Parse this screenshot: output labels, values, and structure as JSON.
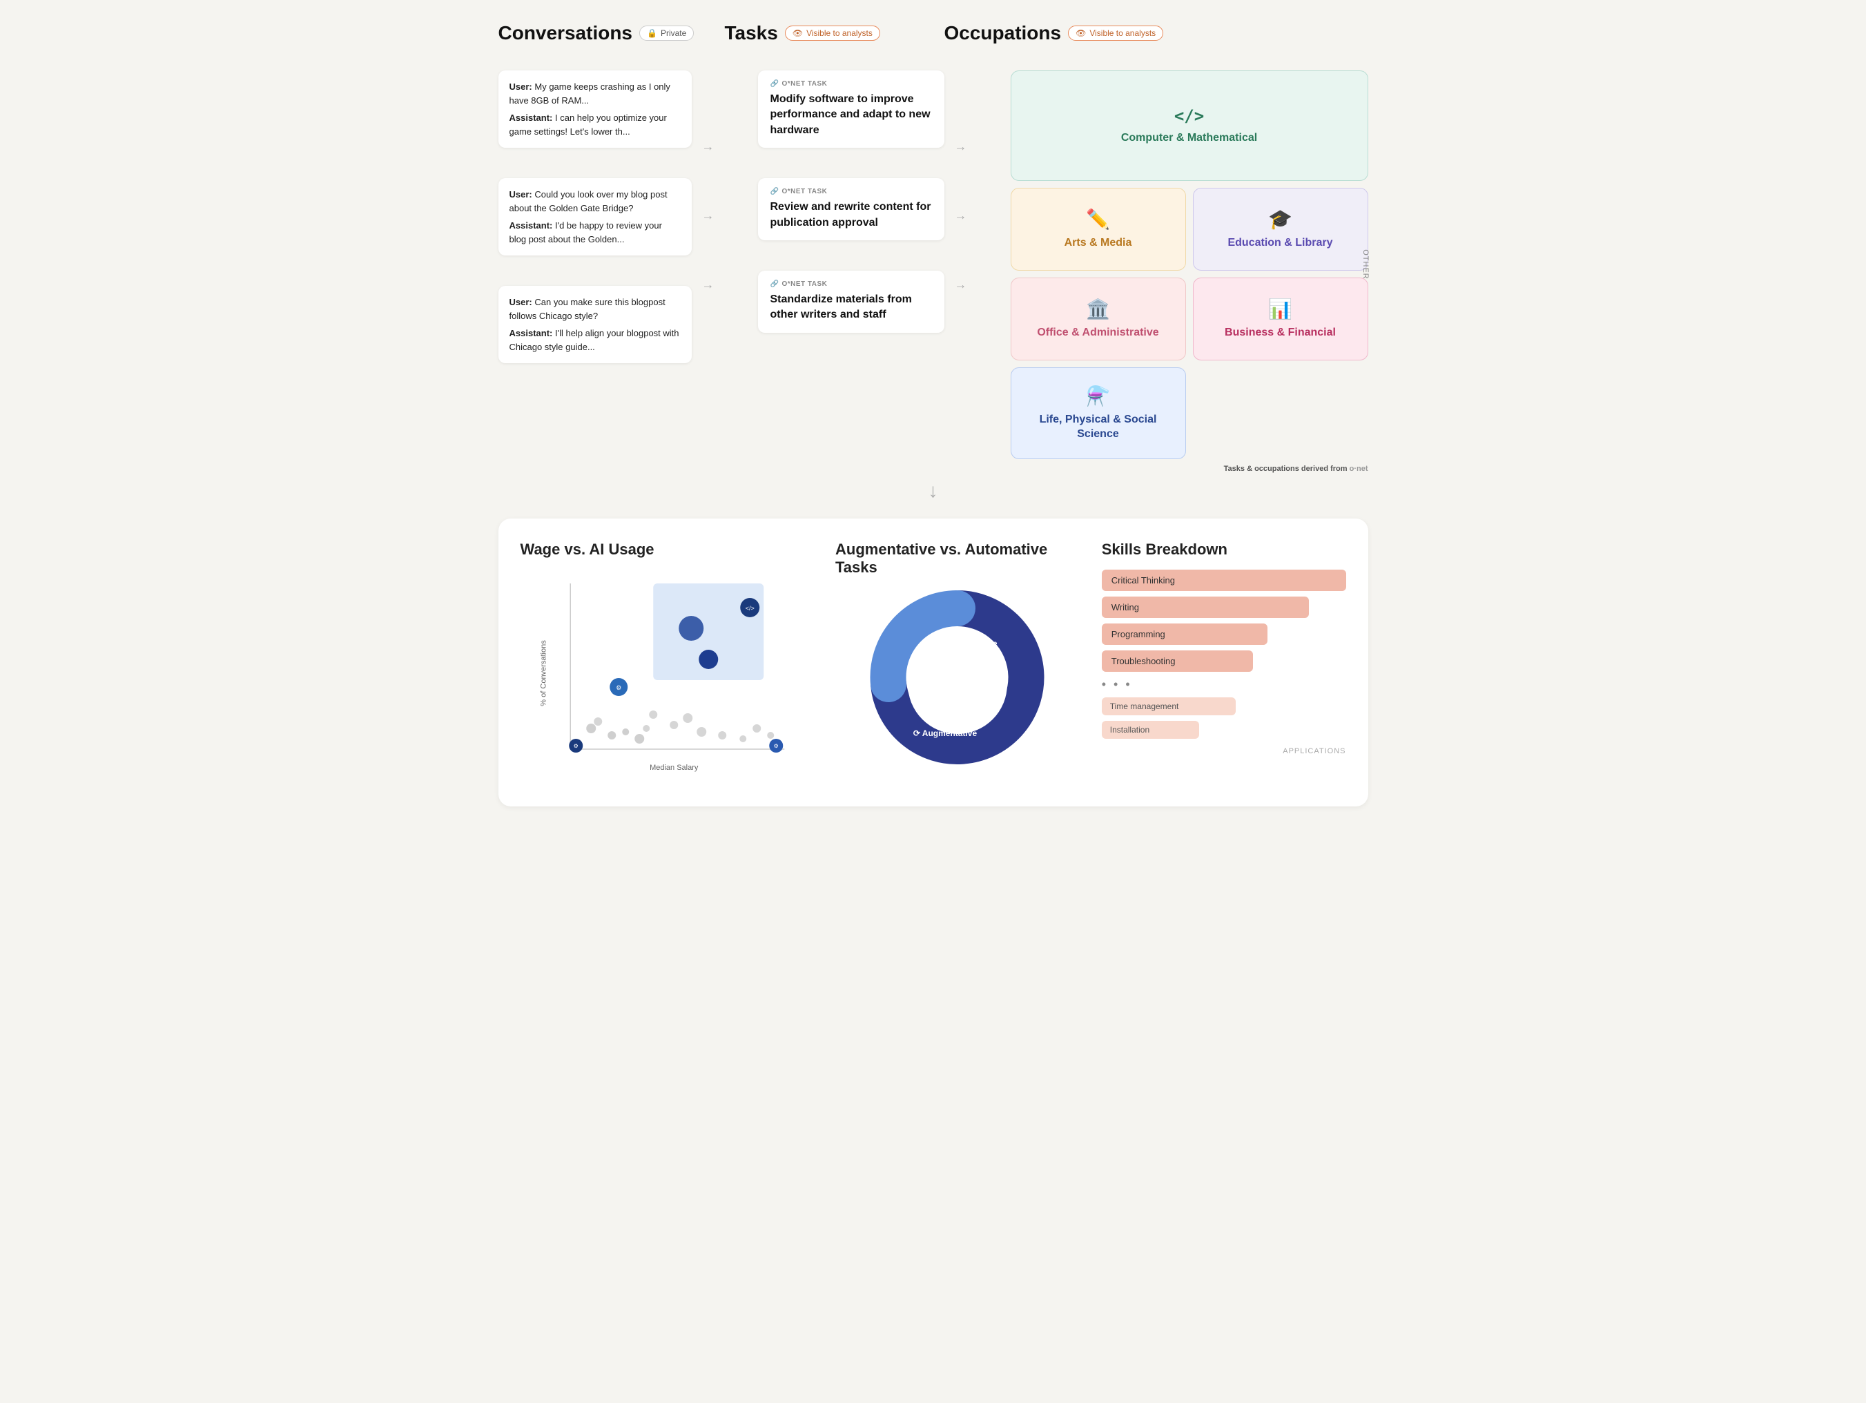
{
  "header": {
    "conversations_title": "Conversations",
    "tasks_title": "Tasks",
    "occupations_title": "Occupations",
    "private_badge": "Private",
    "visible_analysts_badge": "Visible to analysts"
  },
  "conversations": [
    {
      "user_text": "My game keeps crashing as I only have 8GB of RAM...",
      "assistant_text": "I can help you optimize your game settings! Let's lower th..."
    },
    {
      "user_text": "Could you look over my blog post about the Golden Gate Bridge?",
      "assistant_text": "I'd be happy to review your blog post about the Golden..."
    },
    {
      "user_text": "Can you make sure this blogpost follows Chicago style?",
      "assistant_text": "I'll help align your blogpost with Chicago style guide..."
    }
  ],
  "tasks": [
    {
      "label": "O*NET TASK",
      "text": "Modify software to improve performance and adapt to new hardware"
    },
    {
      "label": "O*NET TASK",
      "text": "Review and rewrite content for publication approval"
    },
    {
      "label": "O*NET TASK",
      "text": "Standardize materials from other writers and staff"
    }
  ],
  "occupations": [
    {
      "id": "computer-mathematical",
      "title": "Computer & Mathematical",
      "icon": "</>",
      "color_class": "occ-card-teal occ-card-large",
      "text_class": "occ-teal-text"
    },
    {
      "id": "arts-media",
      "title": "Arts & Media",
      "icon": "✏",
      "color_class": "occ-card-amber",
      "text_class": "occ-amber-text"
    },
    {
      "id": "education-library",
      "title": "Education & Library",
      "icon": "🎓",
      "color_class": "occ-card-purple",
      "text_class": "occ-purple-text"
    },
    {
      "id": "office-administrative",
      "title": "Office & Administrative",
      "icon": "🏛",
      "color_class": "occ-card-pink",
      "text_class": "occ-pink-text"
    },
    {
      "id": "business-financial",
      "title": "Business & Financial",
      "icon": "📊",
      "color_class": "occ-card-rose",
      "text_class": "occ-rose-text"
    },
    {
      "id": "life-science",
      "title": "Life, Physical & Social Science",
      "icon": "⚗",
      "color_class": "occ-card-blue-light",
      "text_class": "occ-blue-text"
    }
  ],
  "onet_ref": "Tasks & occupations derived from",
  "onet_brand": "o·net",
  "bottom": {
    "wage_chart_title": "Wage vs. AI Usage",
    "wage_y_label": "% of Conversations",
    "wage_x_label": "Median Salary",
    "donut_title": "Augmentative vs. Automative Tasks",
    "donut_label_auto": "Automative",
    "donut_label_aug": "Augmentative",
    "skills_title": "Skills Breakdown",
    "skills": [
      {
        "name": "Critical Thinking",
        "width": 100
      },
      {
        "name": "Writing",
        "width": 88
      },
      {
        "name": "Programming",
        "width": 70
      },
      {
        "name": "Troubleshooting",
        "width": 63
      }
    ],
    "skills_more": [
      {
        "name": "Time management",
        "width": 55
      },
      {
        "name": "Installation",
        "width": 45
      }
    ],
    "applications_label": "APPLICATIONS"
  }
}
